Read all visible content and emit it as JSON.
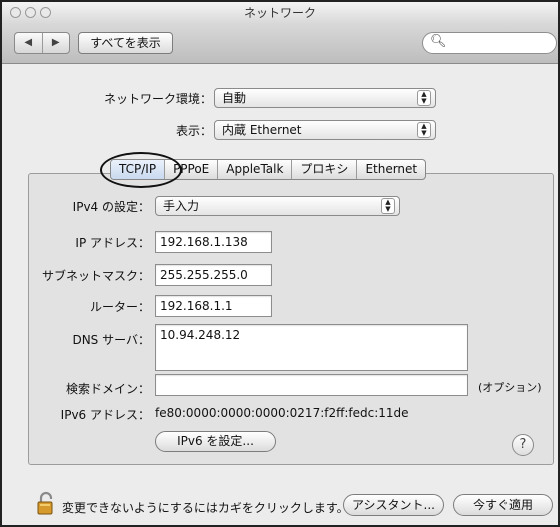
{
  "window": {
    "title": "ネットワーク"
  },
  "toolbar": {
    "nav_back": "◀",
    "nav_forward": "▶",
    "show_all_label": "すべてを表示",
    "search_icon": "search-icon",
    "search_placeholder": ""
  },
  "environment": {
    "label": "ネットワーク環境：",
    "value": "自動"
  },
  "show": {
    "label": "表示：",
    "value": "内蔵 Ethernet"
  },
  "tabs": [
    {
      "label": "TCP/IP",
      "active": true
    },
    {
      "label": "PPPoE",
      "active": false
    },
    {
      "label": "AppleTalk",
      "active": false
    },
    {
      "label": "プロキシ",
      "active": false
    },
    {
      "label": "Ethernet",
      "active": false
    }
  ],
  "tcpip": {
    "ipv4_label": "IPv4 の設定：",
    "ipv4_value": "手入力",
    "ip_label": "IP アドレス：",
    "ip_value": "192.168.1.138",
    "subnet_label": "サブネットマスク：",
    "subnet_value": "255.255.255.0",
    "router_label": "ルーター：",
    "router_value": "192.168.1.1",
    "dns_label": "DNS サーバ：",
    "dns_value": "10.94.248.12",
    "search_domain_label": "検索ドメイン：",
    "search_domain_value": "",
    "optional_label": "(オプション)",
    "ipv6_label": "IPv6 アドレス：",
    "ipv6_value": "fe80:0000:0000:0000:0217:f2ff:fedc:11de",
    "ipv6_button": "IPv6 を設定...",
    "help_label": "?"
  },
  "footer": {
    "lock_icon": "lock-icon",
    "lock_text": "変更できないようにするにはカギをクリックします。",
    "assistant_button": "アシスタント...",
    "apply_button": "今すぐ適用"
  },
  "colors": {
    "window_bg": "#ececec",
    "tab_active": "#c9d9ef",
    "border": "#222222"
  }
}
